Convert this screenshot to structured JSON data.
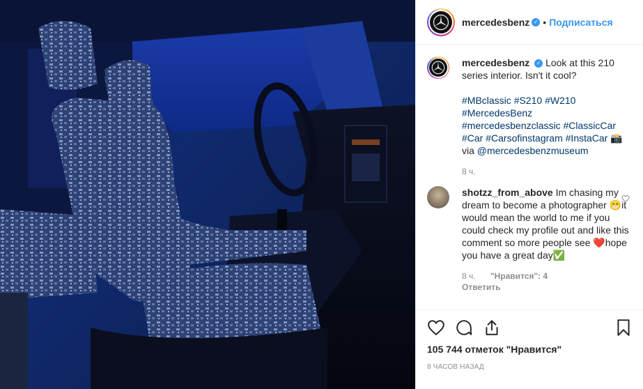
{
  "post": {
    "author": "mercedesbenz",
    "follow_label": "Подписаться",
    "separator": "•"
  },
  "caption": {
    "author": "mercedesbenz",
    "text": "Look at this 210 series interior. Isn't it cool?",
    "hashtags": [
      "#MBclassic",
      "#S210",
      "#W210",
      "#MercedesBenz",
      "#mercedesbenzclassic",
      "#ClassicCar",
      "#Car",
      "#Carsofinstagram",
      "#InstaCar"
    ],
    "camera_emoji": "📸",
    "via_label": "via",
    "mention": "@mercedesbenzmuseum",
    "time": "8 ч."
  },
  "comment": {
    "author": "shotzz_from_above",
    "text_part1": "Im chasing my dream to become a photographer",
    "emoji1": "😁",
    "text_part2": "it would mean the world to me if you could check my profile out and like this comment so more people see",
    "emoji2": "❤️",
    "text_part3": "hope you have a great day",
    "emoji3": "✅",
    "time": "8 ч.",
    "likes": "\"Нравится\": 4",
    "reply_label": "Ответить"
  },
  "footer": {
    "likes_text": "105 744 отметок \"Нравится\"",
    "time_ago": "8 часов назад"
  },
  "icons": {
    "like": "heart-icon",
    "comment": "comment-icon",
    "share": "share-icon",
    "save": "bookmark-icon",
    "verified": "verified-badge-icon",
    "avatar_logo": "mercedes-star-icon"
  },
  "colors": {
    "link": "#3897f0",
    "hashtag": "#00376b",
    "muted": "#8e8e8e",
    "text": "#262626",
    "verified": "#3897f0"
  }
}
